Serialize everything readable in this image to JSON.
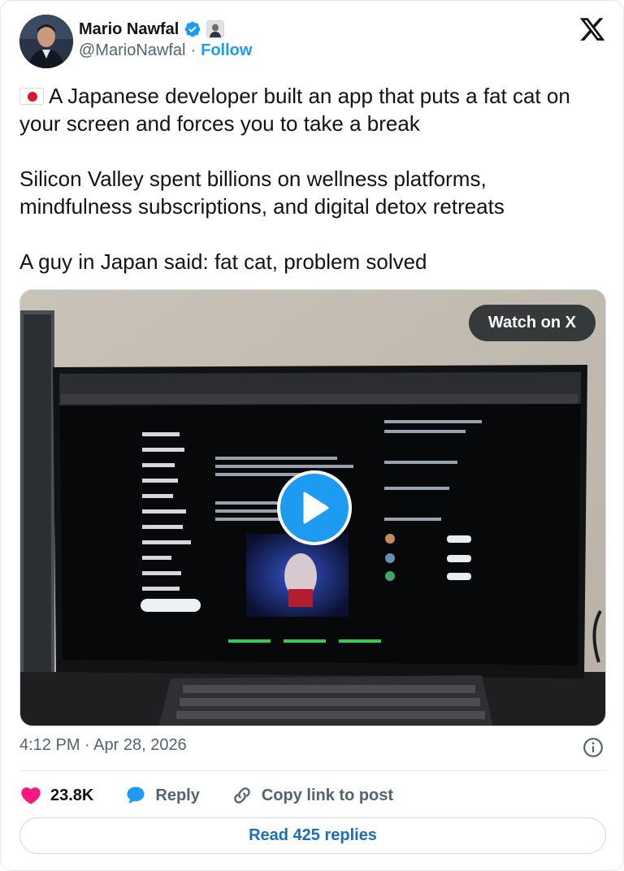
{
  "author": {
    "display_name": "Mario Nawfal",
    "handle": "@MarioNawfal",
    "separator": "·",
    "follow_label": "Follow"
  },
  "tweet": {
    "text": "A Japanese developer built an app that puts a fat cat on your screen and forces you to take a break\n\nSilicon Valley spent billions on wellness platforms, mindfulness subscriptions, and digital detox retreats\n\nA guy in Japan said: fat cat, problem solved"
  },
  "media": {
    "watch_label": "Watch on X"
  },
  "timestamp": "4:12 PM · Apr 28, 2026",
  "actions": {
    "like_count": "23.8K",
    "reply_label": "Reply",
    "copy_link_label": "Copy link to post"
  },
  "read_replies_label": "Read 425 replies",
  "colors": {
    "accent": "#1d9bf0",
    "like": "#f91880",
    "text_secondary": "#536471",
    "link_dark": "#1d6fb8"
  },
  "icons": [
    "verified-badge-icon",
    "affiliate-badge-icon",
    "x-logo-icon",
    "japan-flag-icon",
    "play-icon",
    "info-icon",
    "heart-icon",
    "reply-bubble-icon",
    "link-icon"
  ]
}
